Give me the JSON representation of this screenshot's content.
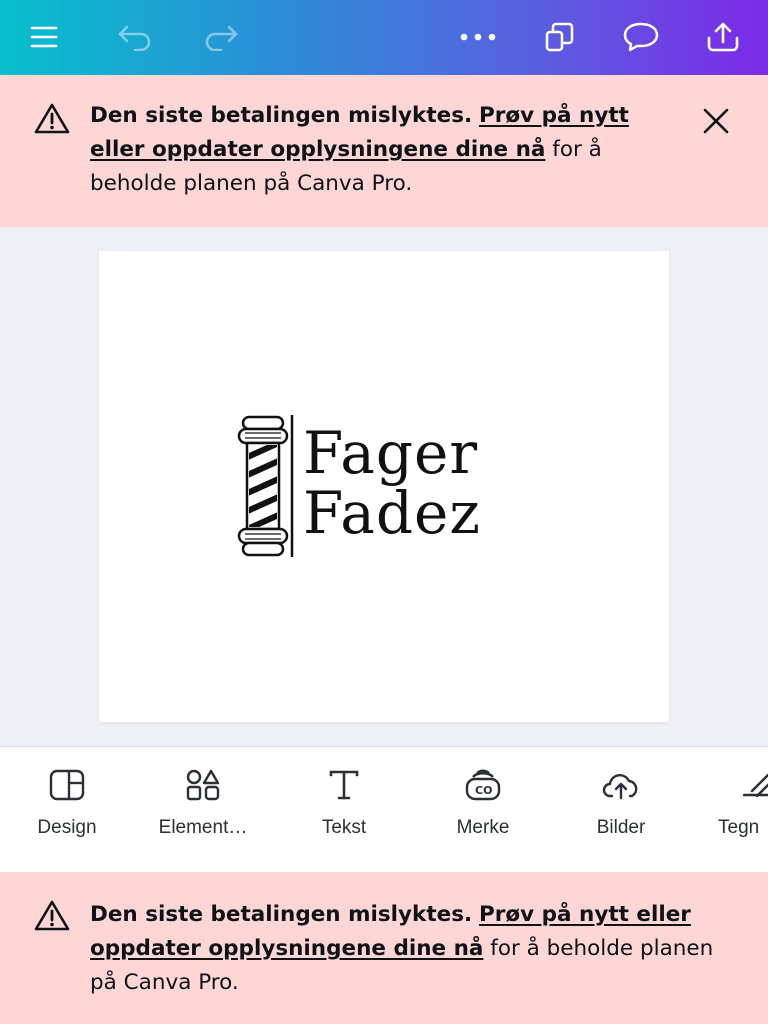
{
  "topbar": {
    "menu_icon": "hamburger-icon",
    "undo_icon": "undo-icon",
    "redo_icon": "redo-icon",
    "more_icon": "more-horizontal-icon",
    "pages_icon": "pages-icon",
    "comment_icon": "comment-icon",
    "share_icon": "share-upload-icon"
  },
  "banner_top": {
    "lead": "Den siste betalingen mislyktes.",
    "link": "Prøv på nytt eller oppdater opplysningene dine nå",
    "tail": "for å beholde planen på Canva Pro.",
    "icon": "warning-icon",
    "close_icon": "close-icon"
  },
  "design": {
    "logo_line1": "Fager",
    "logo_line2": "Fadez",
    "logo_graphic": "barber-pole"
  },
  "toolbar": {
    "items": [
      {
        "label": "Design",
        "icon": "design-icon"
      },
      {
        "label": "Element…",
        "icon": "elements-icon"
      },
      {
        "label": "Tekst",
        "icon": "text-icon"
      },
      {
        "label": "Merke",
        "icon": "brand-icon"
      },
      {
        "label": "Bilder",
        "icon": "upload-cloud-icon"
      },
      {
        "label": "Tegn",
        "icon": "draw-icon"
      }
    ]
  },
  "banner_bottom": {
    "lead": "Den siste betalingen mislyktes.",
    "link": "Prøv på nytt eller oppdater opplysningene dine nå",
    "tail": "for å beholde planen på Canva Pro.",
    "icon": "warning-icon"
  },
  "colors": {
    "gradient_start": "#06c0cc",
    "gradient_end": "#7c2ae8",
    "banner_bg": "#ffd6d6",
    "workspace_bg": "#eef0f5"
  }
}
